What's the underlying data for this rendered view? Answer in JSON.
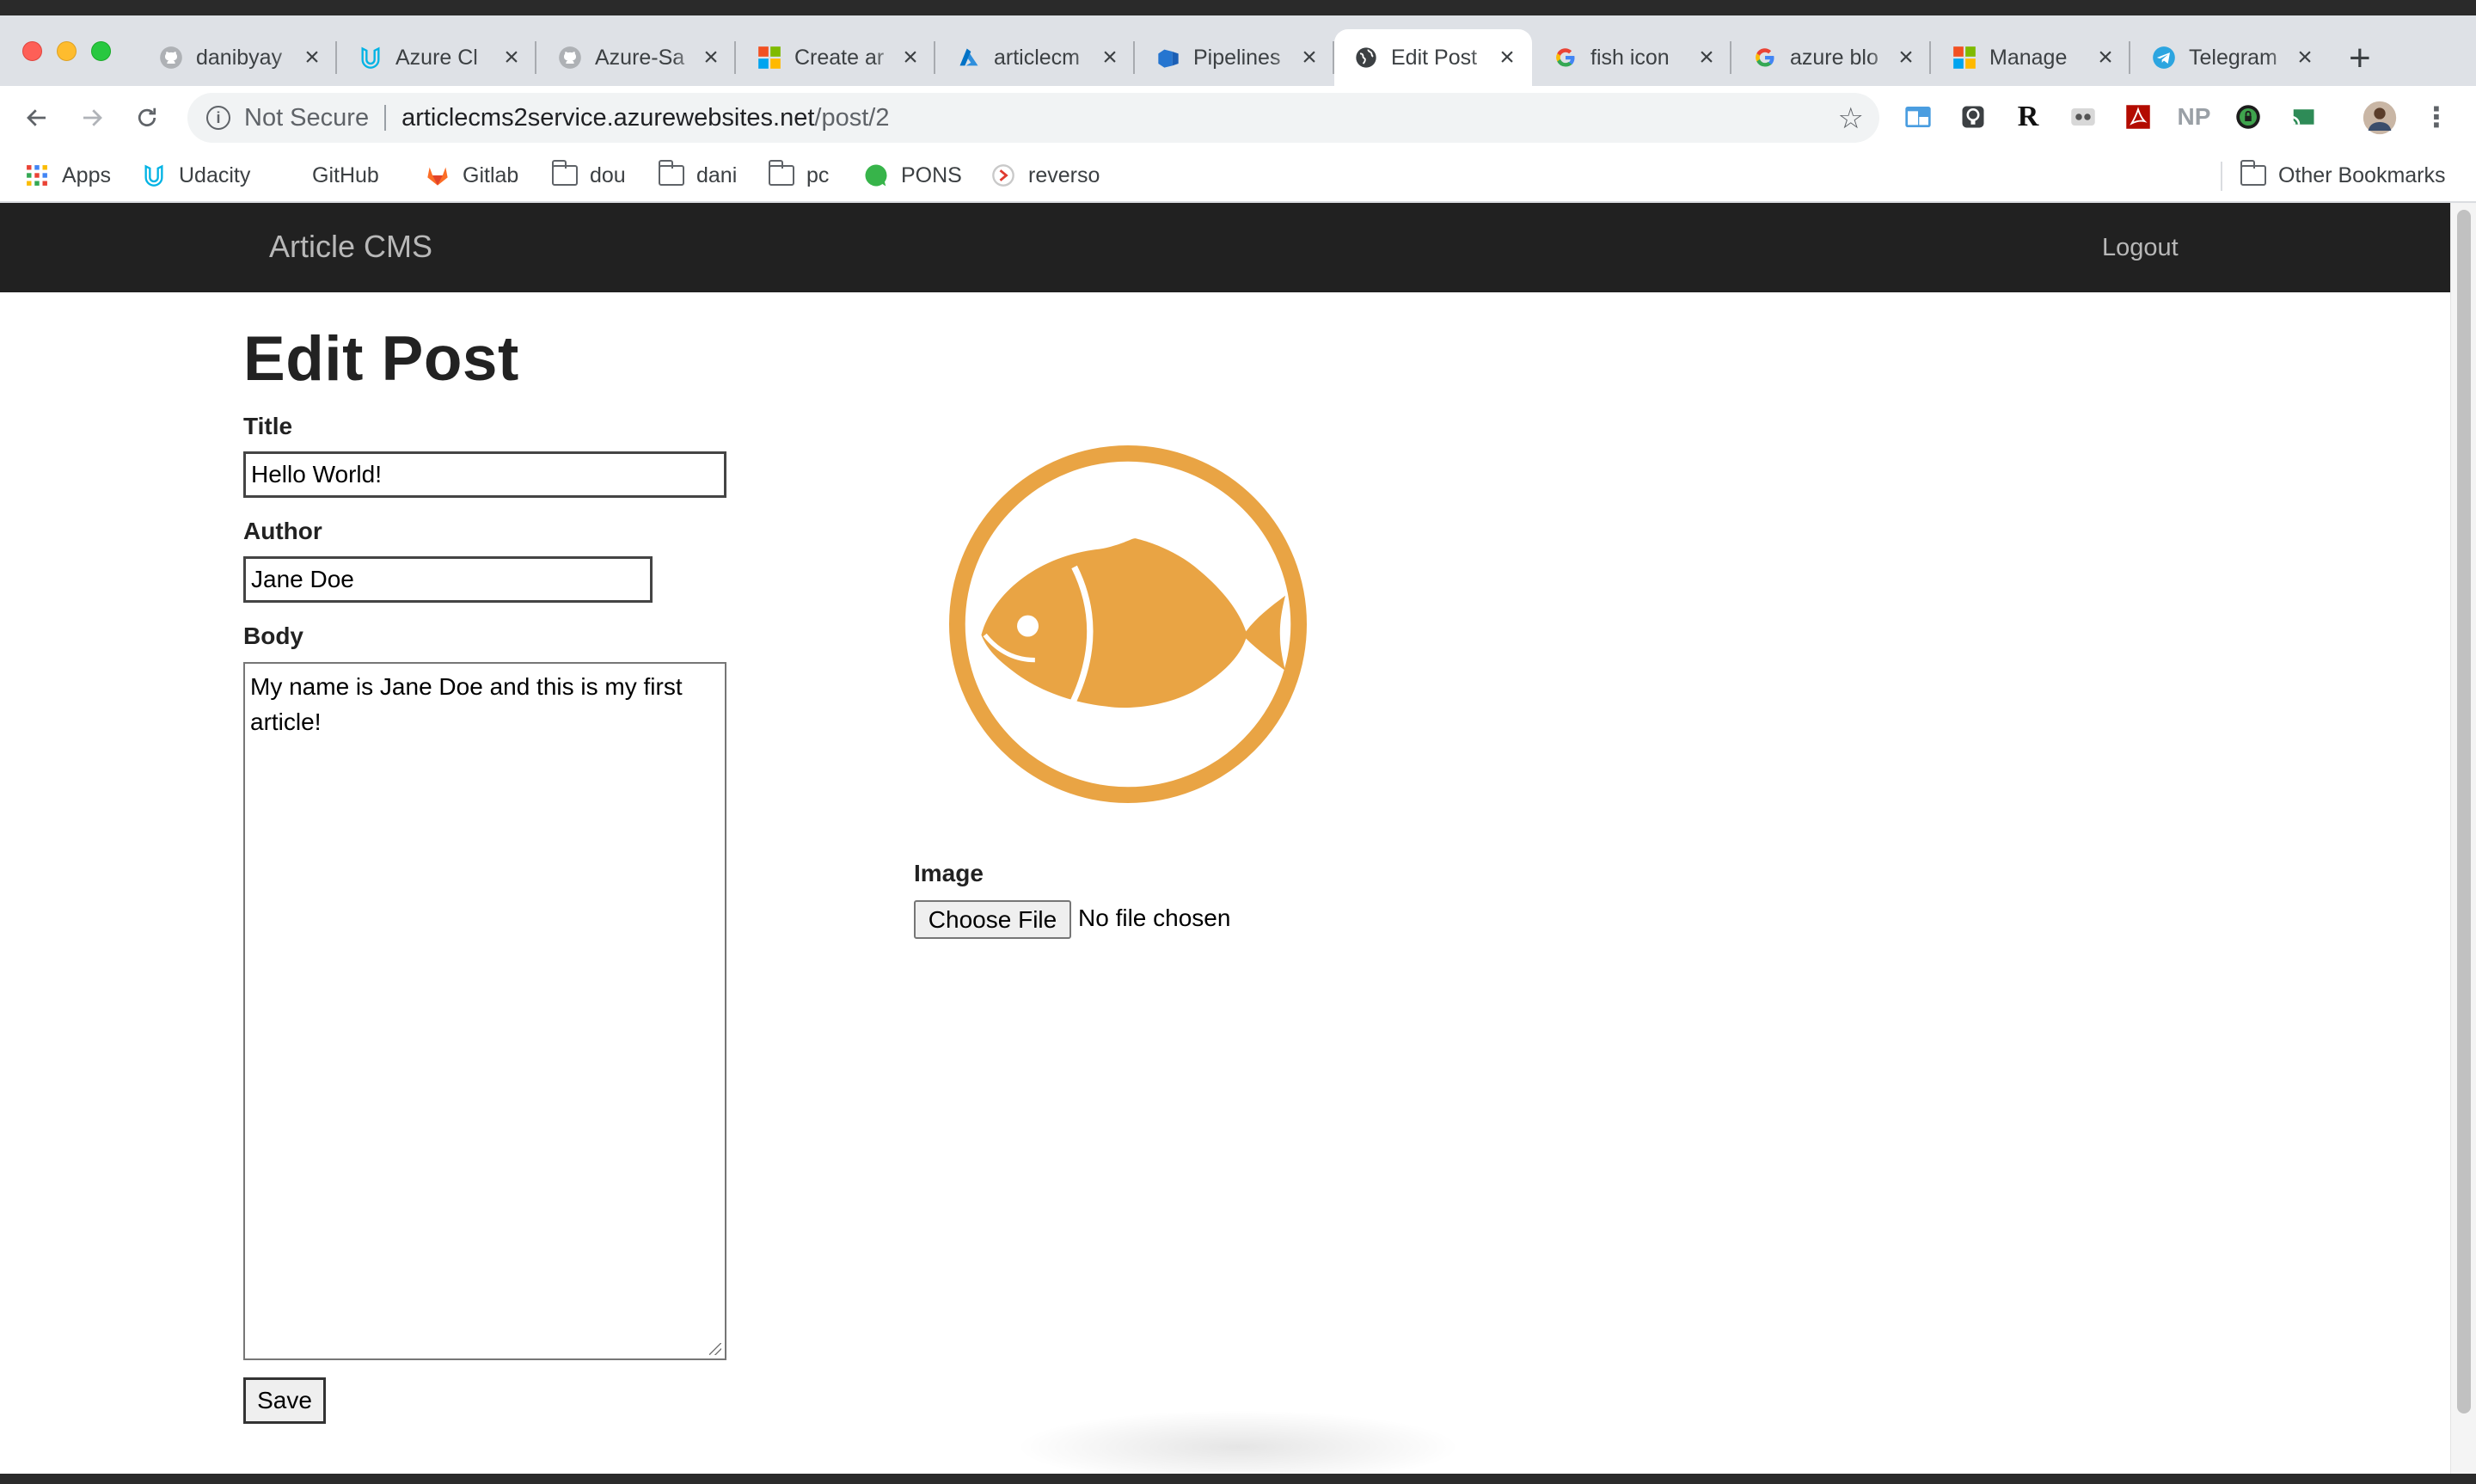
{
  "browser": {
    "tabs": [
      {
        "label": "danibyay",
        "icon": "github-icon",
        "active": false
      },
      {
        "label": "Azure Cl",
        "icon": "udacity-icon",
        "active": false
      },
      {
        "label": "Azure-Sa",
        "icon": "github-icon",
        "active": false
      },
      {
        "label": "Create ar",
        "icon": "microsoft-icon",
        "active": false
      },
      {
        "label": "articlecm",
        "icon": "azure-icon",
        "active": false
      },
      {
        "label": "Pipelines",
        "icon": "azure-devops-icon",
        "active": false
      },
      {
        "label": "Edit Post",
        "icon": "globe-icon",
        "active": true
      },
      {
        "label": "fish icon",
        "icon": "google-icon",
        "active": false
      },
      {
        "label": "azure blo",
        "icon": "google-icon",
        "active": false
      },
      {
        "label": "Manage",
        "icon": "microsoft-icon",
        "active": false
      },
      {
        "label": "Telegram",
        "icon": "telegram-icon",
        "active": false
      }
    ],
    "address": {
      "security": "Not Secure",
      "host": "articlecms2service.azurewebsites.net",
      "path": "/post/2"
    },
    "extensions": [
      "R",
      "NP"
    ],
    "bookmarks": [
      {
        "label": "Apps",
        "icon": "apps-grid-icon"
      },
      {
        "label": "Udacity",
        "icon": "udacity-icon"
      },
      {
        "label": "GitHub",
        "icon": "github-icon"
      },
      {
        "label": "Gitlab",
        "icon": "gitlab-icon"
      },
      {
        "label": "dou",
        "icon": "folder-icon"
      },
      {
        "label": "dani",
        "icon": "folder-icon"
      },
      {
        "label": "pc",
        "icon": "folder-icon"
      },
      {
        "label": "PONS",
        "icon": "pons-icon"
      },
      {
        "label": "reverso",
        "icon": "reverso-icon"
      }
    ],
    "other_bookmarks": "Other Bookmarks"
  },
  "app": {
    "brand": "Article CMS",
    "logout": "Logout"
  },
  "form": {
    "heading": "Edit Post",
    "title_label": "Title",
    "title_value": "Hello World!",
    "author_label": "Author",
    "author_value": "Jane Doe",
    "body_label": "Body",
    "body_value": "My name is Jane Doe and this is my first article!",
    "save_label": "Save",
    "image_label": "Image",
    "choose_file_label": "Choose File",
    "no_file_text": "No file chosen",
    "image_icon": "fish-icon",
    "accent_color": "#E9A444"
  }
}
